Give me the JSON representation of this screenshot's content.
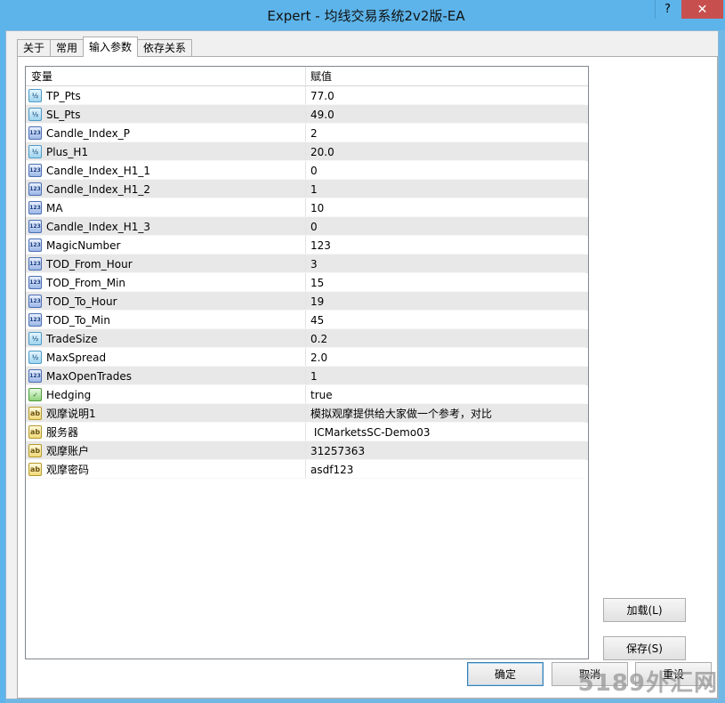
{
  "window": {
    "title": "Expert - 均线交易系统2v2版-EA",
    "help_label": "?",
    "close_label": "✕"
  },
  "tabs": [
    {
      "label": "关于",
      "active": false
    },
    {
      "label": "常用",
      "active": false
    },
    {
      "label": "输入参数",
      "active": true
    },
    {
      "label": "依存关系",
      "active": false
    }
  ],
  "grid": {
    "headers": {
      "variable": "变量",
      "value": "赋值"
    },
    "rows": [
      {
        "type": "double",
        "icon": "half-icon",
        "name": "TP_Pts",
        "value": "77.0"
      },
      {
        "type": "double",
        "icon": "half-icon",
        "name": "SL_Pts",
        "value": "49.0"
      },
      {
        "type": "int",
        "icon": "int-icon",
        "name": "Candle_Index_P",
        "value": "2"
      },
      {
        "type": "double",
        "icon": "half-icon",
        "name": "Plus_H1",
        "value": "20.0"
      },
      {
        "type": "int",
        "icon": "int-icon",
        "name": "Candle_Index_H1_1",
        "value": "0"
      },
      {
        "type": "int",
        "icon": "int-icon",
        "name": "Candle_Index_H1_2",
        "value": "1"
      },
      {
        "type": "int",
        "icon": "int-icon",
        "name": "MA",
        "value": "10"
      },
      {
        "type": "int",
        "icon": "int-icon",
        "name": "Candle_Index_H1_3",
        "value": "0"
      },
      {
        "type": "int",
        "icon": "int-icon",
        "name": "MagicNumber",
        "value": "123"
      },
      {
        "type": "int",
        "icon": "int-icon",
        "name": "TOD_From_Hour",
        "value": "3"
      },
      {
        "type": "int",
        "icon": "int-icon",
        "name": "TOD_From_Min",
        "value": "15"
      },
      {
        "type": "int",
        "icon": "int-icon",
        "name": "TOD_To_Hour",
        "value": "19"
      },
      {
        "type": "int",
        "icon": "int-icon",
        "name": "TOD_To_Min",
        "value": "45"
      },
      {
        "type": "double",
        "icon": "half-icon",
        "name": "TradeSize",
        "value": "0.2"
      },
      {
        "type": "double",
        "icon": "half-icon",
        "name": "MaxSpread",
        "value": "2.0"
      },
      {
        "type": "int",
        "icon": "int-icon",
        "name": "MaxOpenTrades",
        "value": "1"
      },
      {
        "type": "bool",
        "icon": "bool-icon",
        "name": "Hedging",
        "value": "true"
      },
      {
        "type": "string",
        "icon": "string-icon",
        "name": "观摩说明1",
        "value": "模拟观摩提供给大家做一个参考，对比"
      },
      {
        "type": "string",
        "icon": "string-icon",
        "name": "服务器",
        "value": " ICMarketsSC-Demo03"
      },
      {
        "type": "string",
        "icon": "string-icon",
        "name": "观摩账户",
        "value": "31257363"
      },
      {
        "type": "string",
        "icon": "string-icon",
        "name": "观摩密码",
        "value": "asdf123"
      }
    ]
  },
  "icon_glyphs": {
    "double": "½",
    "int": "123",
    "bool": "✓",
    "string": "ab"
  },
  "buttons": {
    "load": "加载(L)",
    "save": "保存(S)",
    "ok": "确定",
    "cancel": "取消",
    "reset": "重设"
  },
  "watermark": "5189外汇网",
  "colors": {
    "titlebar": "#5db4ea",
    "close": "#c7504f",
    "stripe": "#e8e8e8"
  }
}
